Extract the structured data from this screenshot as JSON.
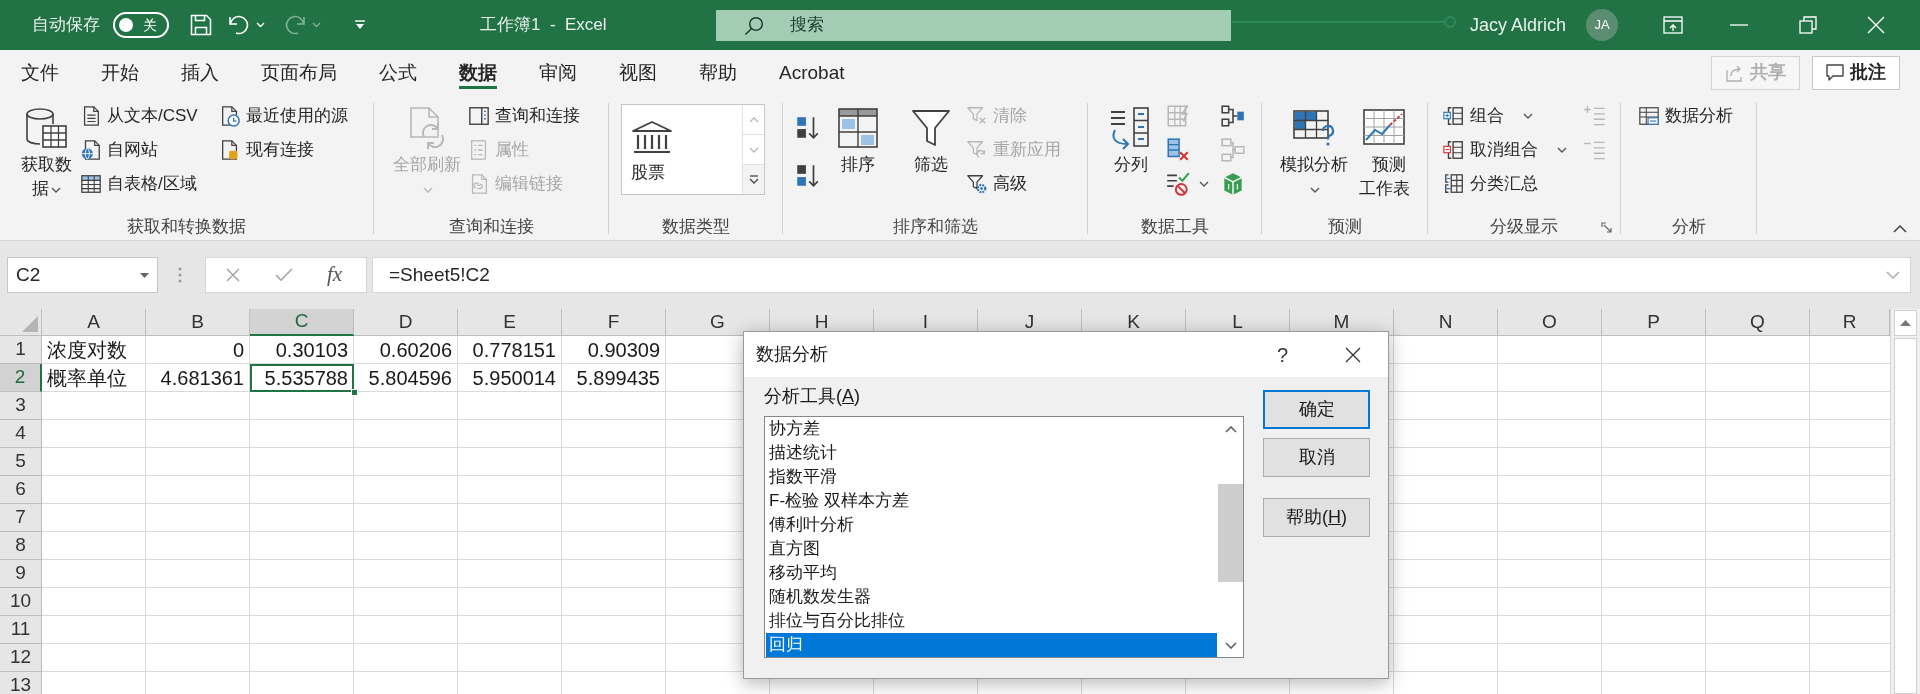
{
  "title_bar": {
    "autosave_label": "自动保存",
    "autosave": {
      "on": false,
      "label": "关"
    },
    "quick_access": [
      {
        "kind": "save",
        "disabled": false
      },
      {
        "kind": "undo",
        "disabled": false,
        "has_menu": true
      },
      {
        "kind": "redo",
        "disabled": true,
        "has_menu": true
      },
      {
        "kind": "customize",
        "disabled": false
      }
    ],
    "document_title": "工作簿1  -  Excel",
    "search": {
      "placeholder": "搜索"
    },
    "user_name": "Jacy Aldrich",
    "avatar_initials": "JA"
  },
  "ribbon_tabs": [
    {
      "label": "文件",
      "selected": false
    },
    {
      "label": "开始",
      "selected": false
    },
    {
      "label": "插入",
      "selected": false
    },
    {
      "label": "页面布局",
      "selected": false
    },
    {
      "label": "公式",
      "selected": false
    },
    {
      "label": "数据",
      "selected": true
    },
    {
      "label": "审阅",
      "selected": false
    },
    {
      "label": "视图",
      "selected": false
    },
    {
      "label": "帮助",
      "selected": false
    },
    {
      "label": "Acrobat",
      "selected": false
    }
  ],
  "share_button": {
    "label": "共享",
    "disabled": true
  },
  "comments_button": {
    "label": "批注"
  },
  "ribbon_groups": [
    {
      "label": "获取和转换数据",
      "columns": [
        [
          {
            "kind": "large",
            "label": "获取数据",
            "disabled": false,
            "has_menu": true
          }
        ],
        [
          {
            "kind": "small",
            "label": "从文本/CSV",
            "disabled": false
          },
          {
            "kind": "small",
            "label": "自网站",
            "disabled": false
          },
          {
            "kind": "small",
            "label": "自表格/区域",
            "disabled": false
          }
        ],
        [
          {
            "kind": "small",
            "label": "最近使用的源",
            "disabled": false
          },
          {
            "kind": "small",
            "label": "现有连接",
            "disabled": false
          }
        ]
      ]
    },
    {
      "label": "查询和连接",
      "columns": [
        [
          {
            "kind": "large",
            "label": "全部刷新",
            "disabled": true,
            "has_menu": true
          }
        ],
        [
          {
            "kind": "small",
            "label": "查询和连接",
            "disabled": false
          },
          {
            "kind": "small",
            "label": "属性",
            "disabled": true
          },
          {
            "kind": "small",
            "label": "编辑链接",
            "disabled": true
          }
        ]
      ]
    },
    {
      "label": "数据类型",
      "columns": [
        [
          {
            "kind": "gallery",
            "label": "股票",
            "disabled": false
          }
        ]
      ]
    },
    {
      "label": "排序和筛选",
      "columns": [
        [
          {
            "kind": "icon",
            "disabled": false
          },
          {
            "kind": "icon",
            "disabled": false
          }
        ],
        [
          {
            "kind": "large",
            "label": "排序",
            "disabled": false
          }
        ],
        [
          {
            "kind": "large",
            "label": "筛选",
            "disabled": false
          }
        ],
        [
          {
            "kind": "small",
            "label": "清除",
            "disabled": true
          },
          {
            "kind": "small",
            "label": "重新应用",
            "disabled": true
          },
          {
            "kind": "small",
            "label": "高级",
            "disabled": false
          }
        ]
      ]
    },
    {
      "label": "数据工具",
      "columns": [
        [
          {
            "kind": "large",
            "label": "分列",
            "disabled": false
          }
        ],
        [
          {
            "kind": "icon",
            "disabled": true
          },
          {
            "kind": "icon",
            "disabled": false
          },
          {
            "kind": "icon",
            "disabled": false,
            "has_menu": true
          }
        ],
        [
          {
            "kind": "icon",
            "disabled": false
          },
          {
            "kind": "icon",
            "disabled": true
          },
          {
            "kind": "icon",
            "disabled": false
          }
        ]
      ]
    },
    {
      "label": "预测",
      "columns": [
        [
          {
            "kind": "large",
            "label": "模拟分析",
            "disabled": false,
            "has_menu": true
          }
        ],
        [
          {
            "kind": "large",
            "label": "预测工作表",
            "disabled": false
          }
        ]
      ]
    },
    {
      "label": "分级显示",
      "has_launcher": true,
      "columns": [
        [
          {
            "kind": "small",
            "label": "组合",
            "disabled": false,
            "has_menu": true
          },
          {
            "kind": "small",
            "label": "取消组合",
            "disabled": false,
            "has_menu": true
          },
          {
            "kind": "small",
            "label": "分类汇总",
            "disabled": false
          }
        ],
        [
          {
            "kind": "icon",
            "disabled": true
          },
          {
            "kind": "icon",
            "disabled": true
          }
        ]
      ]
    },
    {
      "label": "分析",
      "columns": [
        [
          {
            "kind": "small",
            "label": "数据分析",
            "disabled": false
          }
        ]
      ]
    }
  ],
  "formula_bar": {
    "name_box": "C2",
    "insert_function_label": "fx",
    "formula": "=Sheet5!C2"
  },
  "sheet": {
    "columns": [
      {
        "label": "A",
        "selected": false
      },
      {
        "label": "B",
        "selected": false
      },
      {
        "label": "C",
        "selected": true
      },
      {
        "label": "D",
        "selected": false
      },
      {
        "label": "E",
        "selected": false
      },
      {
        "label": "F",
        "selected": false
      },
      {
        "label": "G",
        "selected": false
      },
      {
        "label": "H",
        "selected": false
      },
      {
        "label": "I",
        "selected": false
      },
      {
        "label": "J",
        "selected": false
      },
      {
        "label": "K",
        "selected": false
      },
      {
        "label": "L",
        "selected": false
      },
      {
        "label": "M",
        "selected": false
      },
      {
        "label": "N",
        "selected": false
      },
      {
        "label": "O",
        "selected": false
      },
      {
        "label": "P",
        "selected": false
      },
      {
        "label": "Q",
        "selected": false
      },
      {
        "label": "R",
        "selected": false
      }
    ],
    "rows": [
      {
        "label": "1",
        "selected": false,
        "cells": [
          {
            "text": "浓度对数",
            "kind": "text",
            "selected": false
          },
          {
            "text": "0",
            "kind": "number",
            "selected": false
          },
          {
            "text": "0.30103",
            "kind": "number",
            "selected": false
          },
          {
            "text": "0.60206",
            "kind": "number",
            "selected": false
          },
          {
            "text": "0.778151",
            "kind": "number",
            "selected": false
          },
          {
            "text": "0.90309",
            "kind": "number",
            "selected": false
          }
        ]
      },
      {
        "label": "2",
        "selected": true,
        "cells": [
          {
            "text": "概率单位",
            "kind": "text",
            "selected": false
          },
          {
            "text": "4.681361",
            "kind": "number",
            "selected": false
          },
          {
            "text": "5.535788",
            "kind": "number",
            "selected": true
          },
          {
            "text": "5.804596",
            "kind": "number",
            "selected": false
          },
          {
            "text": "5.950014",
            "kind": "number",
            "selected": false
          },
          {
            "text": "5.899435",
            "kind": "number",
            "selected": false
          }
        ]
      },
      {
        "label": "3",
        "selected": false
      },
      {
        "label": "4",
        "selected": false
      },
      {
        "label": "5",
        "selected": false
      },
      {
        "label": "6",
        "selected": false
      },
      {
        "label": "7",
        "selected": false
      },
      {
        "label": "8",
        "selected": false
      },
      {
        "label": "9",
        "selected": false
      },
      {
        "label": "10",
        "selected": false
      },
      {
        "label": "11",
        "selected": false
      },
      {
        "label": "12",
        "selected": false
      },
      {
        "label": "13",
        "selected": false
      }
    ]
  },
  "dialog": {
    "title": "数据分析",
    "help_glyph": "?",
    "list_label": {
      "text_before": "分析工具(",
      "access_key": "A",
      "text_after": ")"
    },
    "items": [
      {
        "label": "协方差",
        "selected": false
      },
      {
        "label": "描述统计",
        "selected": false
      },
      {
        "label": "指数平滑",
        "selected": false
      },
      {
        "label": "F-检验 双样本方差",
        "selected": false
      },
      {
        "label": "傅利叶分析",
        "selected": false
      },
      {
        "label": "直方图",
        "selected": false
      },
      {
        "label": "移动平均",
        "selected": false
      },
      {
        "label": "随机数发生器",
        "selected": false
      },
      {
        "label": "排位与百分比排位",
        "selected": false
      },
      {
        "label": "回归",
        "selected": true
      }
    ],
    "buttons": [
      {
        "text_before": "确定",
        "default": true
      },
      {
        "text_before": "取消",
        "default": false
      },
      {
        "text_before": "帮助(",
        "access_key": "H",
        "text_after": ")",
        "default": false
      }
    ]
  }
}
